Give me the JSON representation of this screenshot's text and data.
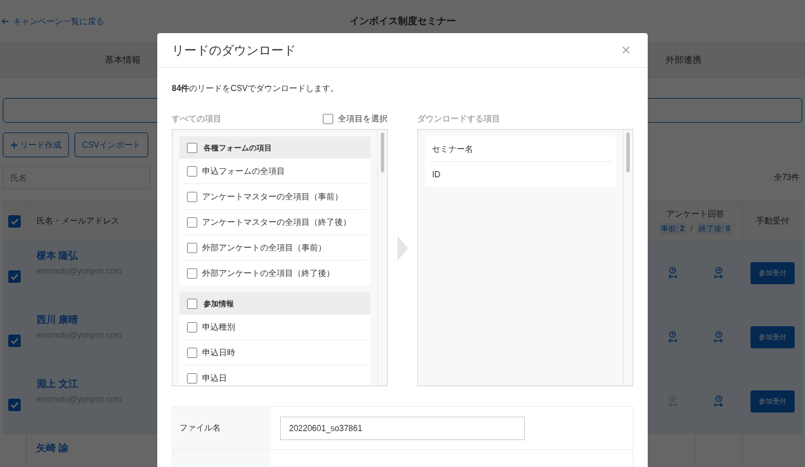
{
  "page": {
    "back_link": "キャンペーン一覧に戻る",
    "title": "インボイス制度セミナー",
    "tabs": [
      {
        "label": "基本情報",
        "selected": false
      },
      {
        "label": "外部連携",
        "selected": false
      }
    ],
    "buttons": [
      {
        "kind": "add",
        "label": "リード作成"
      },
      {
        "kind": "plain",
        "label": "CSVインポート"
      }
    ],
    "name_filter": {
      "placeholder": "氏名"
    },
    "total": "全73件",
    "table": {
      "header_checked": true,
      "name_column": "氏名・メールアドレス",
      "survey_column": "アンケート回答",
      "pre_label": "事前:",
      "pre_count": "2",
      "separator": "/",
      "post_label": "終了後:",
      "post_count": "0",
      "manual_column": "手動受付",
      "rows": [
        {
          "name": "榎本 隆弘",
          "email": "enomoto@yonyon.com",
          "checked": true,
          "pre_answered": true,
          "post_answered": true,
          "action": "参加受付"
        },
        {
          "name": "西川 康晴",
          "email": "enomoto@yonyon.com",
          "checked": true,
          "pre_answered": true,
          "post_answered": true,
          "action": "参加受付"
        },
        {
          "name": "淵上 文江",
          "email": "enomoto@yonyon.com",
          "checked": true,
          "pre_answered": false,
          "post_answered": true,
          "action": "参加受付"
        },
        {
          "name": "矢崎 諭"
        }
      ]
    }
  },
  "modal": {
    "title": "リードのダウンロード",
    "summary": "**84件**のリードをCSVでダウンロードします。",
    "all_label": "すべての項目",
    "select_all": {
      "label": "全項目を選択",
      "checked": false
    },
    "selected_label": "ダウンロードする項目",
    "groups": [
      {
        "title": "各種フォームの項目",
        "checked": false,
        "items": [
          {
            "label": "申込フォームの全項目",
            "checked": false
          },
          {
            "label": "アンケートマスターの全項目（事前）",
            "checked": false
          },
          {
            "label": "アンケートマスターの全項目（終了後）",
            "checked": false
          },
          {
            "label": "外部アンケートの全項目（事前）",
            "checked": false
          },
          {
            "label": "外部アンケートの全項目（終了後）",
            "checked": false
          }
        ]
      },
      {
        "title": "参加情報",
        "checked": false,
        "items": [
          {
            "label": "申込種別",
            "checked": false
          },
          {
            "label": "申込日時",
            "checked": false
          },
          {
            "label": "申込日",
            "checked": false
          }
        ]
      }
    ],
    "selected_items": [
      "セミナー名",
      "ID"
    ],
    "file_name": {
      "label": "ファイル名",
      "value": "20220601_so37861"
    }
  }
}
